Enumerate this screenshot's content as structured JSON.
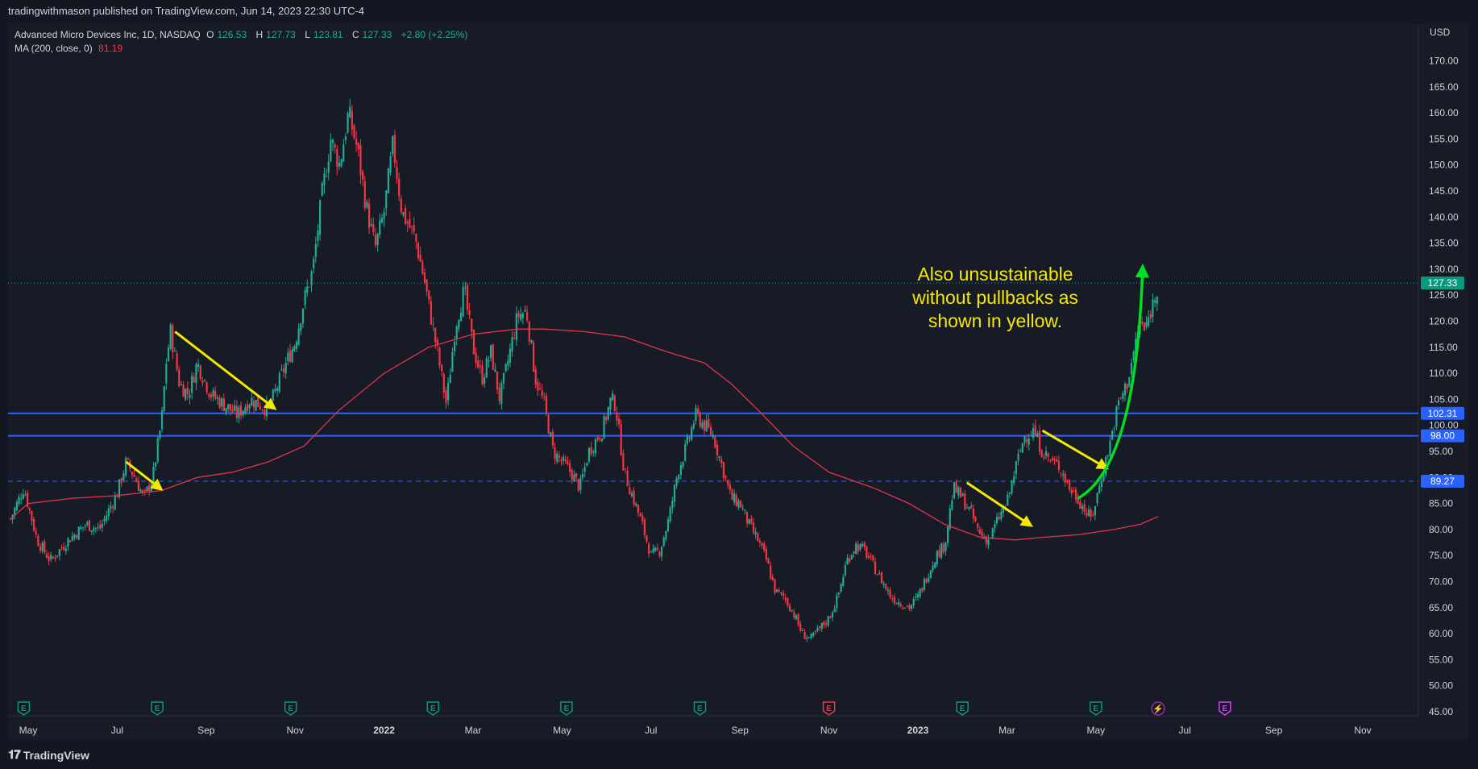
{
  "header": {
    "publisher": "tradingwithmason published on TradingView.com, Jun 14, 2023 22:30 UTC-4"
  },
  "legend": {
    "symbol": "Advanced Micro Devices Inc, 1D, NASDAQ",
    "o_label": "O",
    "o": "126.53",
    "h_label": "H",
    "h": "127.73",
    "l_label": "L",
    "l": "123.81",
    "c_label": "C",
    "c": "127.33",
    "change": "+2.80 (+2.25%)",
    "ma_label": "MA (200, close, 0)",
    "ma_value": "81.19"
  },
  "currency": "USD",
  "annotation": {
    "lines": [
      "Also unsustainable",
      "without pullbacks as",
      "shown in yellow."
    ]
  },
  "footer": {
    "brand": "TradingView"
  },
  "colors": {
    "up": "#22ab94",
    "down": "#f23645",
    "ma": "#e5334a",
    "level": "#2962ff",
    "arrow": "#f5e900",
    "green_arrow": "#00e020",
    "bg": "#131722"
  },
  "chart_data": {
    "type": "candlestick",
    "symbol": "AMD",
    "interval": "1D",
    "ylim": [
      45,
      175
    ],
    "y_ticks": [
      45,
      50,
      55,
      60,
      65,
      70,
      75,
      80,
      85,
      90,
      95,
      100,
      105,
      110,
      115,
      120,
      125,
      130,
      135,
      140,
      145,
      150,
      155,
      160,
      165,
      170
    ],
    "x_ticks": [
      {
        "label": "May",
        "t": 0.0
      },
      {
        "label": "Jul",
        "t": 2.0
      },
      {
        "label": "Sep",
        "t": 4.0
      },
      {
        "label": "Nov",
        "t": 6.0
      },
      {
        "label": "2022",
        "t": 8.0,
        "bold": true
      },
      {
        "label": "Mar",
        "t": 10.0
      },
      {
        "label": "May",
        "t": 12.0
      },
      {
        "label": "Jul",
        "t": 14.0
      },
      {
        "label": "Sep",
        "t": 16.0
      },
      {
        "label": "Nov",
        "t": 18.0
      },
      {
        "label": "2023",
        "t": 20.0,
        "bold": true
      },
      {
        "label": "Mar",
        "t": 22.0
      },
      {
        "label": "May",
        "t": 24.0
      },
      {
        "label": "Jul",
        "t": 26.0
      },
      {
        "label": "Sep",
        "t": 28.0
      },
      {
        "label": "Nov",
        "t": 30.0
      }
    ],
    "t_start": -0.4,
    "t_end": 31.6,
    "last_t": 25.4,
    "price_path": [
      [
        -0.4,
        82
      ],
      [
        -0.1,
        88
      ],
      [
        0.2,
        78
      ],
      [
        0.5,
        74
      ],
      [
        0.9,
        78
      ],
      [
        1.3,
        81
      ],
      [
        1.6,
        80
      ],
      [
        2.0,
        87
      ],
      [
        2.2,
        93
      ],
      [
        2.4,
        90
      ],
      [
        2.6,
        86
      ],
      [
        2.8,
        90
      ],
      [
        3.0,
        101
      ],
      [
        3.1,
        112
      ],
      [
        3.2,
        118
      ],
      [
        3.4,
        108
      ],
      [
        3.6,
        106
      ],
      [
        3.8,
        112
      ],
      [
        4.1,
        106
      ],
      [
        4.4,
        104
      ],
      [
        4.7,
        102
      ],
      [
        5.0,
        105
      ],
      [
        5.4,
        103
      ],
      [
        5.8,
        112
      ],
      [
        6.0,
        116
      ],
      [
        6.2,
        124
      ],
      [
        6.4,
        130
      ],
      [
        6.6,
        144
      ],
      [
        6.8,
        155
      ],
      [
        7.0,
        150
      ],
      [
        7.2,
        160
      ],
      [
        7.4,
        153
      ],
      [
        7.6,
        142
      ],
      [
        7.8,
        134
      ],
      [
        8.0,
        141
      ],
      [
        8.2,
        154
      ],
      [
        8.4,
        141
      ],
      [
        8.7,
        136
      ],
      [
        8.9,
        128
      ],
      [
        9.2,
        114
      ],
      [
        9.4,
        104
      ],
      [
        9.6,
        119
      ],
      [
        9.8,
        126
      ],
      [
        10.0,
        115
      ],
      [
        10.2,
        109
      ],
      [
        10.4,
        114
      ],
      [
        10.6,
        105
      ],
      [
        10.8,
        113
      ],
      [
        11.0,
        121
      ],
      [
        11.2,
        122
      ],
      [
        11.4,
        109
      ],
      [
        11.6,
        104
      ],
      [
        11.8,
        95
      ],
      [
        12.2,
        91
      ],
      [
        12.4,
        88
      ],
      [
        12.6,
        95
      ],
      [
        12.9,
        99
      ],
      [
        13.1,
        105
      ],
      [
        13.2,
        104
      ],
      [
        13.4,
        91
      ],
      [
        13.6,
        86
      ],
      [
        13.8,
        81
      ],
      [
        14.0,
        75
      ],
      [
        14.2,
        76
      ],
      [
        14.4,
        82
      ],
      [
        14.6,
        91
      ],
      [
        14.8,
        96
      ],
      [
        15.0,
        102
      ],
      [
        15.2,
        100
      ],
      [
        15.4,
        98
      ],
      [
        15.6,
        92
      ],
      [
        15.8,
        86
      ],
      [
        16.0,
        85
      ],
      [
        16.2,
        81
      ],
      [
        16.4,
        78
      ],
      [
        16.6,
        74
      ],
      [
        16.8,
        68
      ],
      [
        17.0,
        67
      ],
      [
        17.2,
        64
      ],
      [
        17.4,
        60
      ],
      [
        17.6,
        59
      ],
      [
        17.8,
        61
      ],
      [
        18.0,
        63
      ],
      [
        18.2,
        67
      ],
      [
        18.4,
        74
      ],
      [
        18.6,
        77
      ],
      [
        18.8,
        76
      ],
      [
        19.0,
        73
      ],
      [
        19.2,
        70
      ],
      [
        19.4,
        67
      ],
      [
        19.6,
        66
      ],
      [
        19.8,
        65
      ],
      [
        20.0,
        67
      ],
      [
        20.2,
        71
      ],
      [
        20.4,
        75
      ],
      [
        20.6,
        77
      ],
      [
        20.8,
        88
      ],
      [
        21.0,
        86
      ],
      [
        21.2,
        83
      ],
      [
        21.4,
        79
      ],
      [
        21.6,
        78
      ],
      [
        21.8,
        82
      ],
      [
        22.0,
        85
      ],
      [
        22.2,
        92
      ],
      [
        22.4,
        98
      ],
      [
        22.6,
        99
      ],
      [
        22.8,
        95
      ],
      [
        23.0,
        93
      ],
      [
        23.2,
        92
      ],
      [
        23.4,
        88
      ],
      [
        23.6,
        86
      ],
      [
        23.8,
        83
      ],
      [
        23.9,
        82
      ],
      [
        24.1,
        89
      ],
      [
        24.3,
        96
      ],
      [
        24.5,
        104
      ],
      [
        24.7,
        108
      ],
      [
        24.9,
        116
      ],
      [
        25.0,
        120
      ],
      [
        25.1,
        118
      ],
      [
        25.3,
        124
      ],
      [
        25.4,
        127.33
      ]
    ],
    "ma_path": [
      [
        -0.4,
        82
      ],
      [
        0.0,
        85
      ],
      [
        1.0,
        86
      ],
      [
        2.0,
        86.5
      ],
      [
        3.0,
        87.5
      ],
      [
        3.8,
        90
      ],
      [
        4.6,
        91
      ],
      [
        5.4,
        93
      ],
      [
        6.2,
        96
      ],
      [
        7.0,
        103
      ],
      [
        8.0,
        110
      ],
      [
        9.0,
        115
      ],
      [
        10.0,
        117.5
      ],
      [
        11.0,
        118.5
      ],
      [
        11.6,
        118.5
      ],
      [
        12.5,
        118
      ],
      [
        13.4,
        117
      ],
      [
        14.4,
        114
      ],
      [
        15.2,
        112
      ],
      [
        15.8,
        108
      ],
      [
        16.4,
        103
      ],
      [
        17.2,
        96
      ],
      [
        18.0,
        91
      ],
      [
        19.0,
        88
      ],
      [
        19.8,
        85
      ],
      [
        20.6,
        81
      ],
      [
        21.4,
        78.5
      ],
      [
        22.2,
        78
      ],
      [
        22.8,
        78.5
      ],
      [
        23.6,
        79
      ],
      [
        24.4,
        80
      ],
      [
        25.0,
        81
      ],
      [
        25.4,
        82.5
      ]
    ],
    "horizontal_levels": [
      {
        "value": 102.31,
        "label": "102.31",
        "style": "solid"
      },
      {
        "value": 98.0,
        "label": "98.00",
        "style": "solid"
      },
      {
        "value": 89.27,
        "label": "89.27",
        "style": "dashed"
      }
    ],
    "last_price": {
      "value": 127.33,
      "label": "127.33"
    },
    "earnings_markers": [
      {
        "t": -0.1,
        "kind": "E",
        "color": "#089981"
      },
      {
        "t": 2.9,
        "kind": "E",
        "color": "#089981"
      },
      {
        "t": 5.9,
        "kind": "E",
        "color": "#089981"
      },
      {
        "t": 9.1,
        "kind": "E",
        "color": "#089981"
      },
      {
        "t": 12.1,
        "kind": "E",
        "color": "#089981"
      },
      {
        "t": 15.1,
        "kind": "E",
        "color": "#089981"
      },
      {
        "t": 18.0,
        "kind": "E",
        "color": "#f23645"
      },
      {
        "t": 21.0,
        "kind": "E",
        "color": "#089981"
      },
      {
        "t": 24.0,
        "kind": "E",
        "color": "#089981"
      },
      {
        "t": 25.4,
        "kind": "bolt",
        "color": "#9c27b0"
      },
      {
        "t": 26.9,
        "kind": "E",
        "color": "#e040fb"
      }
    ],
    "arrows": [
      {
        "color": "yellow",
        "from": [
          2.2,
          93
        ],
        "to": [
          2.95,
          88
        ]
      },
      {
        "color": "yellow",
        "from": [
          3.3,
          118
        ],
        "to": [
          5.5,
          103.5
        ]
      },
      {
        "color": "yellow",
        "from": [
          21.1,
          89
        ],
        "to": [
          22.5,
          81
        ]
      },
      {
        "color": "yellow",
        "from": [
          22.8,
          99
        ],
        "to": [
          24.2,
          92
        ]
      },
      {
        "color": "green",
        "from": [
          23.6,
          86
        ],
        "to": [
          25.05,
          130
        ],
        "curved": true
      }
    ]
  }
}
